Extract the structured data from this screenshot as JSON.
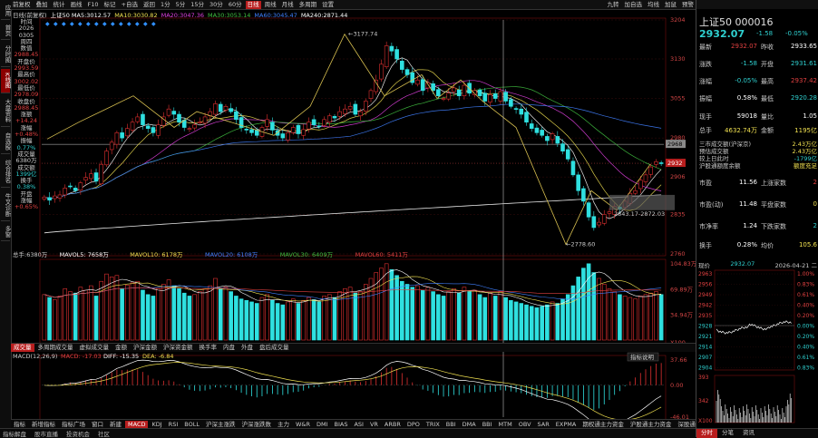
{
  "left_tabs": [
    {
      "label": "应用",
      "active": false
    },
    {
      "label": "首页",
      "active": false
    },
    {
      "label": "分时图",
      "active": false
    },
    {
      "label": "K线图",
      "active": true
    },
    {
      "label": "大盘资料",
      "active": false
    },
    {
      "label": "自选股",
      "active": false
    },
    {
      "label": "综合排名",
      "active": false
    },
    {
      "label": "牛叉诊断",
      "active": false
    },
    {
      "label": "多窗",
      "active": false
    }
  ],
  "toolbar": {
    "items": [
      "前复权",
      "叠加",
      "统计",
      "画线",
      "F10",
      "标记",
      "+自选",
      "返回"
    ],
    "right": [
      "九转",
      "加自选",
      "均线",
      "加鼠",
      "预警"
    ],
    "period": [
      "1分",
      "5分",
      "15分",
      "30分",
      "60分",
      "日线",
      "周线",
      "月线",
      "多周期",
      "设置"
    ]
  },
  "index_title": "上证50 000016",
  "header_row": {
    "label": "日线(前复权)",
    "ma": [
      {
        "name": "上证50 MA5:",
        "value": "3012.57",
        "color": "#ffffff"
      },
      {
        "name": "MA10:",
        "value": "3030.82",
        "color": "#f0e050"
      },
      {
        "name": "MA20:",
        "value": "3047.36",
        "color": "#e040e0"
      },
      {
        "name": "MA30:",
        "value": "3053.14",
        "color": "#40c040"
      },
      {
        "name": "MA60:",
        "value": "3045.47",
        "color": "#4080ff"
      },
      {
        "name": "MA240:",
        "value": "2871.44",
        "color": "#ffffff"
      }
    ]
  },
  "quote_box": [
    {
      "label": "时间",
      "value": "2026",
      "c": "#ccc"
    },
    {
      "label": "",
      "value": "0305",
      "c": "#ccc"
    },
    {
      "label": "",
      "value": "周四",
      "c": "#ccc"
    },
    {
      "label": "数值",
      "value": "",
      "c": "#ccc"
    },
    {
      "label": "",
      "value": "2988.45",
      "c": "#e04040"
    },
    {
      "label": "开盘价",
      "value": "2993.59",
      "c": "#e04040"
    },
    {
      "label": "最高价",
      "value": "3002.02",
      "c": "#e04040"
    },
    {
      "label": "最低价",
      "value": "2978.09",
      "c": "#e04040"
    },
    {
      "label": "收盘价",
      "value": "2988.45",
      "c": "#e04040"
    },
    {
      "label": "涨额",
      "value": "+14.24",
      "c": "#e04040"
    },
    {
      "label": "涨幅",
      "value": "+0.48%",
      "c": "#e04040"
    },
    {
      "label": "振幅",
      "value": "0.77%",
      "c": "#2fd0d0"
    },
    {
      "label": "成交量",
      "value": "6380万",
      "c": "#ccc"
    },
    {
      "label": "成交额",
      "value": "1399亿",
      "c": "#2fd0d0"
    },
    {
      "label": "换手",
      "value": "0.38%",
      "c": "#2fd0d0"
    },
    {
      "label": "开盘",
      "value": "涨幅",
      "c": "#ccc"
    },
    {
      "label": "",
      "value": "+0.65%",
      "c": "#e04040"
    }
  ],
  "price_axis": [
    "3204",
    "3130",
    "3055",
    "2980",
    "2906",
    "2835",
    "2760"
  ],
  "price_markers": {
    "current": "2932",
    "line2968": "2968"
  },
  "annotations": {
    "high": "3177.74",
    "low": "2778.60",
    "box": "2843.17-2872.03"
  },
  "volume_header": {
    "vol": "总手:6380万",
    "mavol5": "MAVOL5: 7658万",
    "mavol10": "MAVOL10: 6178万",
    "mavol20": "MAVOL20: 6108万",
    "mavol30": "MAVOL30: 6409万",
    "mavol60": "MAVOL60: 5411万"
  },
  "volume_axis": [
    "104.83万",
    "69.89万",
    "34.94万",
    "X100"
  ],
  "sub_tabs": [
    "成交量",
    "多周期成交量",
    "虚拟成交量",
    "金额",
    "沪深金额",
    "沪深资金额",
    "换手率",
    "内盘",
    "外盘",
    "盘后成交量"
  ],
  "macd_header": {
    "label": "MACD(12,26,9)",
    "macd": "MACD: -17.03",
    "diff": "DIFF: -15.35",
    "dea": "DEA: -6.84",
    "btn": "指标说明"
  },
  "macd_axis": [
    "37.66",
    "0.00",
    "-46.01"
  ],
  "date_axis": [
    "09",
    "10",
    "11",
    "12",
    "01",
    "02",
    "03",
    "04"
  ],
  "date_highlight": "2026-03-05 周四 振幅1.42%",
  "bottom_tabs": [
    "指标",
    "新增指标",
    "指标广场",
    "窗口",
    "新建",
    "MACD",
    "KDJ",
    "RSI",
    "BOLL",
    "沪深主涨跌",
    "沪深涨跌数",
    "主力",
    "W&R",
    "DMI",
    "BIAS",
    "ASI",
    "VR",
    "ARBR",
    "DPO",
    "TRIX",
    "BBI",
    "DMA",
    "BBI",
    "MTM",
    "OBV",
    "SAR",
    "EXPMA",
    "期权通主力资金",
    "沪股通主力资金",
    "深股通主力资金"
  ],
  "status": [
    "指标解盘",
    "股市直播",
    "投资机会",
    "社区"
  ],
  "panel": {
    "title": "上证50 000016",
    "price": "2932.07",
    "chg": "-1.58",
    "pct": "-0.05%",
    "rows": [
      {
        "l": "最新",
        "v": "2932.07",
        "l2": "昨收",
        "v2": "2933.65",
        "c": "#e04040",
        "c2": "#fff"
      },
      {
        "l": "涨跌",
        "v": "-1.58",
        "l2": "开盘",
        "v2": "2931.61",
        "c": "#2fd0d0",
        "c2": "#2fd0d0"
      },
      {
        "l": "涨幅",
        "v": "-0.05%",
        "l2": "最高",
        "v2": "2937.42",
        "c": "#2fd0d0",
        "c2": "#e04040"
      },
      {
        "l": "振幅",
        "v": "0.58%",
        "l2": "最低",
        "v2": "2920.28",
        "c": "#fff",
        "c2": "#2fd0d0"
      },
      {
        "l": "现手",
        "v": "59018",
        "l2": "量比",
        "v2": "1.05",
        "c": "#fff",
        "c2": "#fff"
      },
      {
        "l": "总手",
        "v": "4632.74万",
        "l2": "金额",
        "v2": "1195亿",
        "c": "#f0e050",
        "c2": "#f0e050"
      }
    ],
    "mid": [
      {
        "l": "三市成交额(沪深京)",
        "v": "2.43万亿"
      },
      {
        "l": "预估成交额",
        "v": "2.43万亿"
      },
      {
        "l": "较上日此时",
        "v": "-1799亿"
      },
      {
        "l": "沪股通额度余额",
        "v": "额度充足"
      }
    ],
    "rows2": [
      {
        "l": "市盈",
        "v": "11.56",
        "l2": "上涨家数",
        "v2": "2"
      },
      {
        "l": "市盈(动)",
        "v": "11.48",
        "l2": "平盘家数",
        "v2": "0"
      },
      {
        "l": "市净率",
        "v": "1.24",
        "l2": "下跌家数",
        "v2": "2"
      },
      {
        "l": "换手",
        "v": "0.28%",
        "l2": "均价",
        "v2": "105.6"
      }
    ],
    "mini": {
      "tab": "现价",
      "price": "2932.07",
      "date": "2026-04-21 二",
      "yticks": [
        "2963",
        "2956",
        "2949",
        "2942",
        "2935",
        "2928",
        "2921",
        "2914",
        "2907",
        "2904"
      ],
      "pct": [
        "1.00%",
        "0.83%",
        "0.61%",
        "0.40%",
        "0.20%",
        "0.00%",
        "0.20%",
        "0.40%",
        "0.61%",
        "0.83%"
      ],
      "vol": [
        "393",
        "342",
        "X100"
      ],
      "bottom_tabs": [
        "分时",
        "分笔",
        "资讯"
      ]
    }
  },
  "chart_data": {
    "type": "candlestick",
    "title": "上证50 000016 日线(前复权)",
    "ylim": [
      2760,
      3204
    ],
    "x_ticks": [
      "09",
      "10",
      "11",
      "12",
      "01",
      "02",
      "03",
      "04"
    ],
    "ohlc_note": "daily candles approximated from chart",
    "close": [
      2868,
      2862,
      2870,
      2872,
      2885,
      2888,
      2880,
      2895,
      2905,
      2912,
      2898,
      2930,
      2955,
      2972,
      2990,
      2980,
      2998,
      3010,
      3020,
      3005,
      2998,
      2990,
      3005,
      3020,
      3035,
      3025,
      3010,
      3000,
      2998,
      3005,
      3010,
      3020,
      3030,
      3045,
      3030,
      3040,
      3030,
      3015,
      3000,
      2995,
      2990,
      2985,
      3000,
      3015,
      2995,
      2985,
      2980,
      2990,
      3000,
      2988,
      2996,
      3010,
      3005,
      3002,
      3015,
      3022,
      3018,
      3030,
      3035,
      3040,
      3025,
      3030,
      3050,
      3070,
      3090,
      3120,
      3155,
      3145,
      3130,
      3110,
      3100,
      3085,
      3090,
      3070,
      3085,
      3070,
      3060,
      3055,
      3065,
      3075,
      3060,
      3080,
      3065,
      3070,
      3060,
      3050,
      3062,
      3055,
      3068,
      3050,
      3040,
      3035,
      3025,
      3010,
      2998,
      2990,
      2985,
      2975,
      2988,
      2970,
      2955,
      2940,
      2910,
      2880,
      2860,
      2830,
      2810,
      2820,
      2835,
      2840,
      2850,
      2845,
      2860,
      2875,
      2880,
      2900,
      2910,
      2925,
      2935,
      2932
    ],
    "volume": [
      62,
      58,
      55,
      60,
      70,
      66,
      64,
      72,
      68,
      74,
      60,
      80,
      90,
      86,
      88,
      70,
      75,
      78,
      80,
      68,
      62,
      60,
      70,
      76,
      82,
      74,
      70,
      64,
      60,
      62,
      66,
      70,
      74,
      84,
      70,
      72,
      66,
      60,
      56,
      54,
      52,
      50,
      58,
      62,
      54,
      50,
      48,
      52,
      56,
      50,
      54,
      58,
      55,
      52,
      60,
      62,
      58,
      66,
      70,
      72,
      64,
      66,
      76,
      84,
      92,
      98,
      104,
      96,
      88,
      80,
      76,
      72,
      74,
      68,
      72,
      66,
      62,
      60,
      66,
      70,
      64,
      72,
      66,
      68,
      62,
      58,
      64,
      60,
      66,
      58,
      54,
      52,
      50,
      48,
      46,
      44,
      46,
      48,
      52,
      50,
      56,
      62,
      74,
      86,
      98,
      104,
      92,
      84,
      76,
      70,
      66,
      62,
      60,
      58,
      56,
      60,
      62,
      64,
      66,
      62
    ],
    "ma240_start": 2800,
    "ma240_end": 2872
  }
}
